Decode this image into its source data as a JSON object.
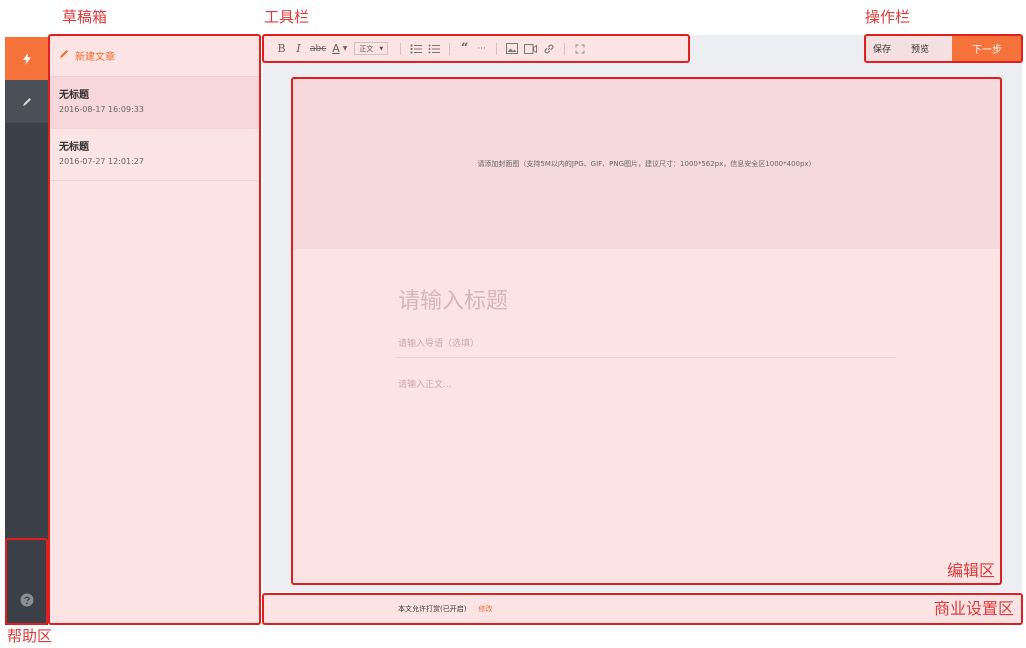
{
  "annotations": {
    "drafts": "草稿箱",
    "toolbar": "工具栏",
    "actions": "操作栏",
    "help": "帮助区",
    "editor": "编辑区",
    "business": "商业设置区"
  },
  "rail": {
    "items": [
      {
        "icon": "lightning-icon",
        "active": true
      },
      {
        "icon": "pen-icon",
        "active": false
      }
    ],
    "help_icon": "help-icon"
  },
  "drafts": {
    "new_label": "新建文章",
    "items": [
      {
        "title": "无标题",
        "time": "2016-08-17 16:09:33",
        "selected": true
      },
      {
        "title": "无标题",
        "time": "2016-07-27 12:01:27",
        "selected": false
      }
    ]
  },
  "toolbar": {
    "bold": "B",
    "italic": "I",
    "strike": "abc",
    "font_color": "A",
    "paragraph_style": "正文"
  },
  "actions": {
    "save": "保存",
    "preview": "预览",
    "next": "下一步"
  },
  "editor": {
    "cover_hint": "请添加封面图（支持5M以内的JPG、GIF、PNG图片，建议尺寸：1000*562px，信息安全区1000*400px）",
    "title_placeholder": "请输入标题",
    "lead_placeholder": "请输入导语（选填）",
    "body_placeholder": "请输入正文..."
  },
  "business": {
    "status": "本文允许打赏(已开启)",
    "edit_link": "修改"
  },
  "colors": {
    "accent": "#f5723a",
    "annotation": "#e02020",
    "rail": "#3b3f47"
  }
}
